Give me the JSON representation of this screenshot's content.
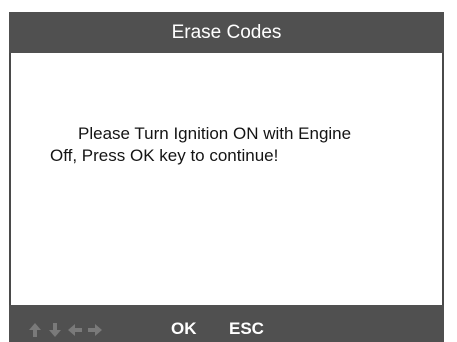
{
  "header": {
    "title": "Erase Codes"
  },
  "message": {
    "text": "Please Turn Ignition ON with Engine Off, Press OK key to continue!"
  },
  "footer": {
    "arrow_icons": [
      "up-arrow-icon",
      "down-arrow-icon",
      "left-arrow-icon",
      "right-arrow-icon"
    ],
    "ok_label": "OK",
    "esc_label": "ESC"
  },
  "colors": {
    "bar_background": "#505050",
    "screen_background": "#ffffff",
    "bar_text": "#ffffff",
    "body_text": "#141414",
    "arrow_dim": "#7a7a7a"
  }
}
